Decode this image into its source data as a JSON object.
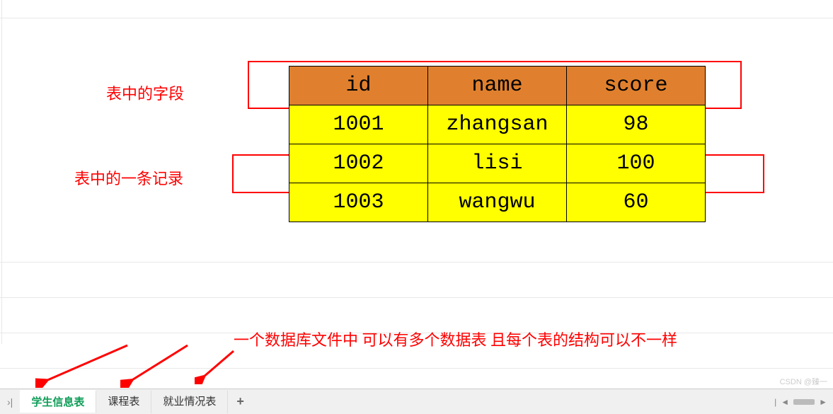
{
  "annotations": {
    "header_label": "表中的字段",
    "row_label": "表中的一条记录",
    "bottom_label": "一个数据库文件中 可以有多个数据表  且每个表的结构可以不一样"
  },
  "table": {
    "headers": [
      "id",
      "name",
      "score"
    ],
    "rows": [
      {
        "id": "1001",
        "name": "zhangsan",
        "score": "98"
      },
      {
        "id": "1002",
        "name": "lisi",
        "score": "100"
      },
      {
        "id": "1003",
        "name": "wangwu",
        "score": "60"
      }
    ]
  },
  "tabs": {
    "items": [
      "学生信息表",
      "课程表",
      "就业情况表"
    ],
    "active_index": 0,
    "add_label": "+"
  },
  "nav": {
    "first": "›|"
  },
  "watermark": "CSDN @臻一",
  "chart_data": {
    "type": "table",
    "title": "",
    "columns": [
      "id",
      "name",
      "score"
    ],
    "rows": [
      [
        "1001",
        "zhangsan",
        "98"
      ],
      [
        "1002",
        "lisi",
        "100"
      ],
      [
        "1003",
        "wangwu",
        "60"
      ]
    ]
  }
}
